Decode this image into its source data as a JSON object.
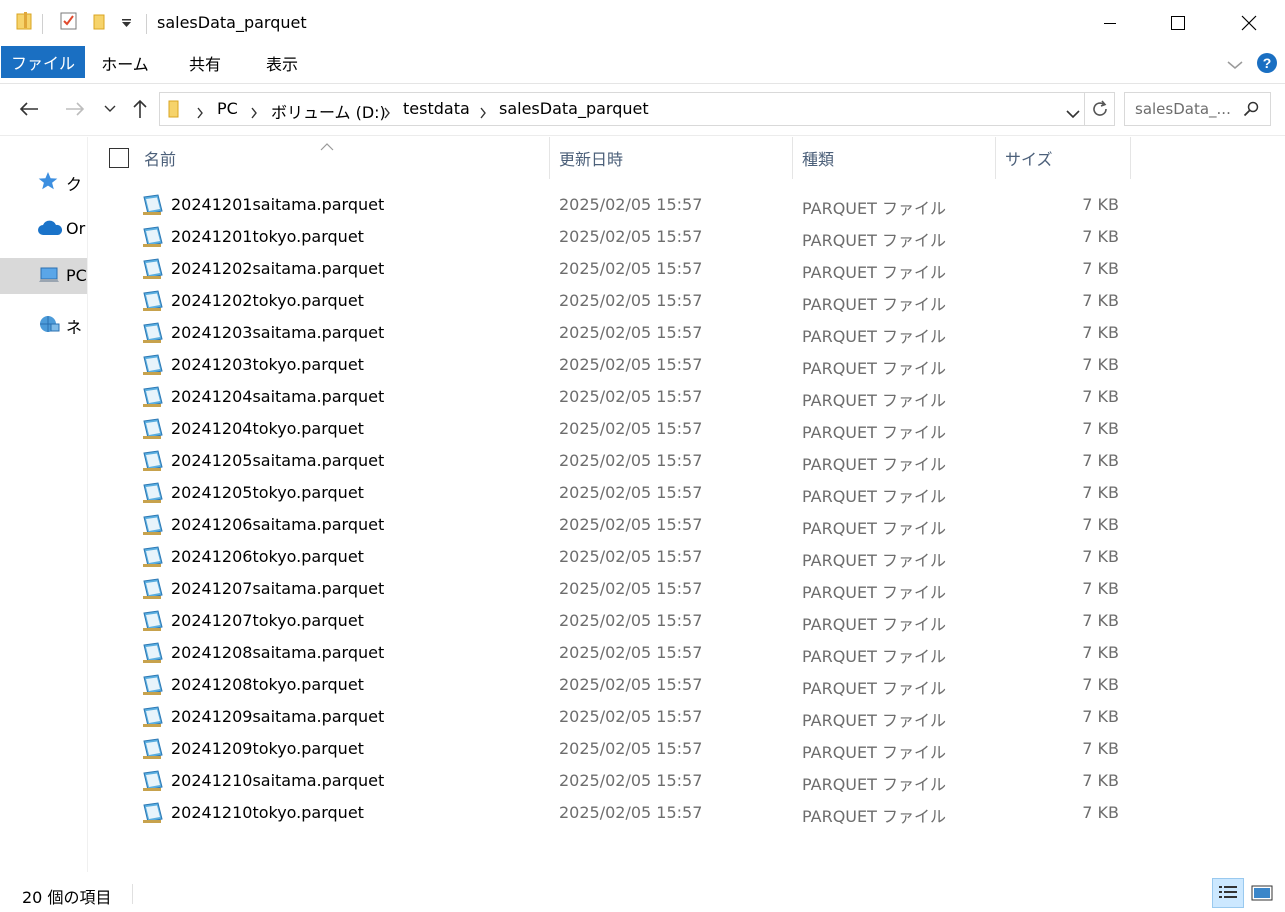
{
  "window": {
    "title": "salesData_parquet"
  },
  "ribbon": {
    "tabs": [
      "ファイル",
      "ホーム",
      "共有",
      "表示"
    ]
  },
  "address": {
    "crumbs": [
      "PC",
      "ボリューム (D:)",
      "testdata",
      "salesData_parquet"
    ],
    "search_placeholder": "salesData_..."
  },
  "sidebar": {
    "items": [
      {
        "label": "ク",
        "icon": "star-icon",
        "selected": false
      },
      {
        "label": "Or",
        "icon": "onedrive-cloud-icon",
        "selected": false
      },
      {
        "label": "PC",
        "icon": "computer-icon",
        "selected": true
      },
      {
        "label": "ネ",
        "icon": "network-icon",
        "selected": false
      }
    ]
  },
  "columns": {
    "name": "名前",
    "modified": "更新日時",
    "type": "種類",
    "size": "サイズ"
  },
  "files": [
    {
      "name": "20241201saitama.parquet",
      "modified": "2025/02/05 15:57",
      "type": "PARQUET ファイル",
      "size": "7 KB"
    },
    {
      "name": "20241201tokyo.parquet",
      "modified": "2025/02/05 15:57",
      "type": "PARQUET ファイル",
      "size": "7 KB"
    },
    {
      "name": "20241202saitama.parquet",
      "modified": "2025/02/05 15:57",
      "type": "PARQUET ファイル",
      "size": "7 KB"
    },
    {
      "name": "20241202tokyo.parquet",
      "modified": "2025/02/05 15:57",
      "type": "PARQUET ファイル",
      "size": "7 KB"
    },
    {
      "name": "20241203saitama.parquet",
      "modified": "2025/02/05 15:57",
      "type": "PARQUET ファイル",
      "size": "7 KB"
    },
    {
      "name": "20241203tokyo.parquet",
      "modified": "2025/02/05 15:57",
      "type": "PARQUET ファイル",
      "size": "7 KB"
    },
    {
      "name": "20241204saitama.parquet",
      "modified": "2025/02/05 15:57",
      "type": "PARQUET ファイル",
      "size": "7 KB"
    },
    {
      "name": "20241204tokyo.parquet",
      "modified": "2025/02/05 15:57",
      "type": "PARQUET ファイル",
      "size": "7 KB"
    },
    {
      "name": "20241205saitama.parquet",
      "modified": "2025/02/05 15:57",
      "type": "PARQUET ファイル",
      "size": "7 KB"
    },
    {
      "name": "20241205tokyo.parquet",
      "modified": "2025/02/05 15:57",
      "type": "PARQUET ファイル",
      "size": "7 KB"
    },
    {
      "name": "20241206saitama.parquet",
      "modified": "2025/02/05 15:57",
      "type": "PARQUET ファイル",
      "size": "7 KB"
    },
    {
      "name": "20241206tokyo.parquet",
      "modified": "2025/02/05 15:57",
      "type": "PARQUET ファイル",
      "size": "7 KB"
    },
    {
      "name": "20241207saitama.parquet",
      "modified": "2025/02/05 15:57",
      "type": "PARQUET ファイル",
      "size": "7 KB"
    },
    {
      "name": "20241207tokyo.parquet",
      "modified": "2025/02/05 15:57",
      "type": "PARQUET ファイル",
      "size": "7 KB"
    },
    {
      "name": "20241208saitama.parquet",
      "modified": "2025/02/05 15:57",
      "type": "PARQUET ファイル",
      "size": "7 KB"
    },
    {
      "name": "20241208tokyo.parquet",
      "modified": "2025/02/05 15:57",
      "type": "PARQUET ファイル",
      "size": "7 KB"
    },
    {
      "name": "20241209saitama.parquet",
      "modified": "2025/02/05 15:57",
      "type": "PARQUET ファイル",
      "size": "7 KB"
    },
    {
      "name": "20241209tokyo.parquet",
      "modified": "2025/02/05 15:57",
      "type": "PARQUET ファイル",
      "size": "7 KB"
    },
    {
      "name": "20241210saitama.parquet",
      "modified": "2025/02/05 15:57",
      "type": "PARQUET ファイル",
      "size": "7 KB"
    },
    {
      "name": "20241210tokyo.parquet",
      "modified": "2025/02/05 15:57",
      "type": "PARQUET ファイル",
      "size": "7 KB"
    }
  ],
  "status": {
    "item_count": "20 個の項目"
  },
  "colors": {
    "file_tab_bg": "#1a6fc2",
    "help_icon": "#1a6fc2",
    "header_text": "#4c607a",
    "secondary_text": "#6d6d6d",
    "selected_nav": "#d9d9d9"
  }
}
